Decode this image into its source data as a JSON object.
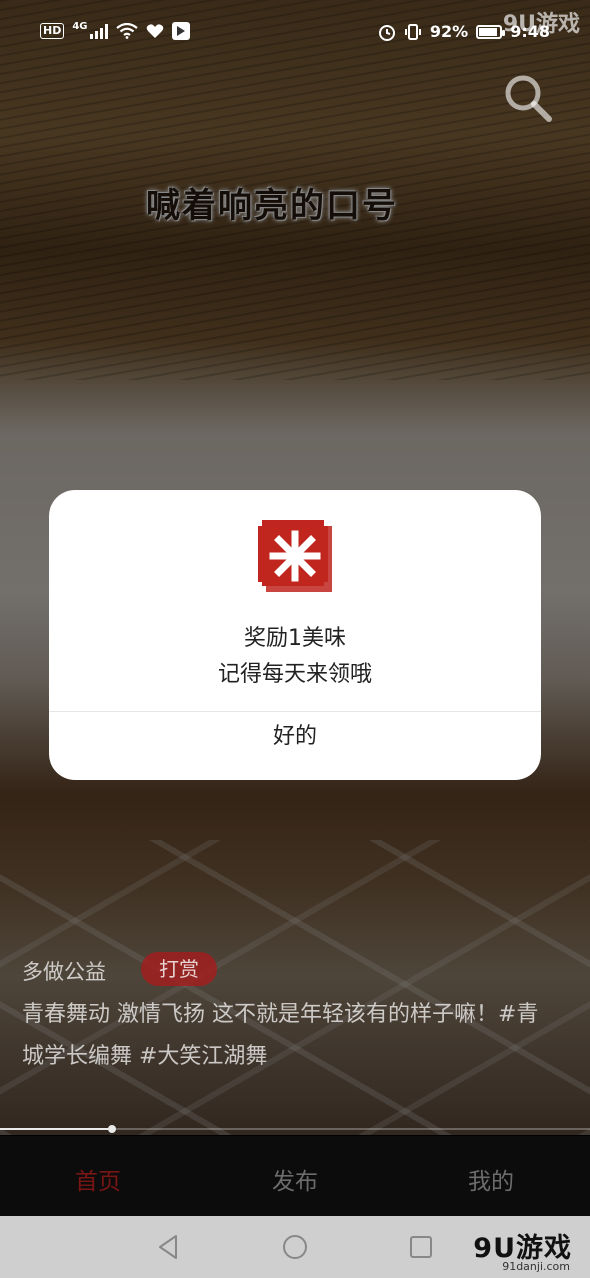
{
  "status_bar": {
    "network_badge": "HD",
    "network_type": "4G",
    "battery_percent": "92%",
    "time": "9:48"
  },
  "watermark_top": "9U游戏",
  "video": {
    "caption": "喊着响亮的口号",
    "progress": 0.19
  },
  "modal": {
    "title": "奖励1美味",
    "subtitle": "记得每天来领哦",
    "ok_label": "好的",
    "logo_color": "#c0261f"
  },
  "post": {
    "author": "多做公益",
    "reward_label": "打赏",
    "description": "青春舞动 激情飞扬 这不就是年轻该有的样子嘛！#青城学长编舞 #大笑江湖舞"
  },
  "tabs": [
    {
      "label": "首页",
      "active": true
    },
    {
      "label": "发布",
      "active": false
    },
    {
      "label": "我的",
      "active": false
    }
  ],
  "watermark_bottom": {
    "brand": "9U游戏",
    "url": "91danji.com"
  },
  "colors": {
    "active_tab": "#7a1515",
    "inactive_tab": "#6c6c6c",
    "reward_bg": "#a01e1e"
  }
}
